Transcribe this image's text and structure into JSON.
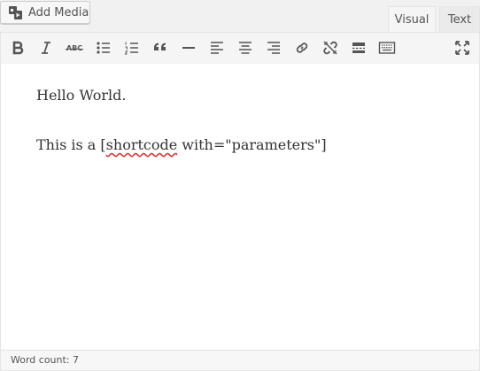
{
  "header": {
    "add_media_label": "Add Media",
    "add_media_icon": "media-icon",
    "tabs": [
      {
        "label": "Visual",
        "active": true
      },
      {
        "label": "Text",
        "active": false
      }
    ]
  },
  "toolbar": {
    "buttons": [
      {
        "name": "bold",
        "icon": "bold-icon"
      },
      {
        "name": "italic",
        "icon": "italic-icon"
      },
      {
        "name": "strikethrough",
        "icon": "strikethrough-icon",
        "glyph": "ABC"
      },
      {
        "name": "bulleted-list",
        "icon": "bulleted-list-icon"
      },
      {
        "name": "numbered-list",
        "icon": "numbered-list-icon"
      },
      {
        "name": "blockquote",
        "icon": "blockquote-icon"
      },
      {
        "name": "horizontal-line",
        "icon": "horizontal-line-icon"
      },
      {
        "name": "align-left",
        "icon": "align-left-icon"
      },
      {
        "name": "align-center",
        "icon": "align-center-icon"
      },
      {
        "name": "align-right",
        "icon": "align-right-icon"
      },
      {
        "name": "insert-link",
        "icon": "link-icon"
      },
      {
        "name": "remove-link",
        "icon": "unlink-icon"
      },
      {
        "name": "read-more",
        "icon": "read-more-icon"
      },
      {
        "name": "toolbar-toggle",
        "icon": "keyboard-icon"
      },
      {
        "name": "fullscreen",
        "icon": "fullscreen-icon"
      }
    ]
  },
  "content": {
    "line1": "Hello World.",
    "line2_before": "This is a [",
    "line2_misspelled": "shortcode",
    "line2_after": " with=\"parameters\"]"
  },
  "status": {
    "word_count": "Word count: 7"
  },
  "colors": {
    "icon": "#555555",
    "spellcheck_underline": "#d63638",
    "toolbar_bg": "#f5f5f5",
    "page_bg": "#f1f1f1"
  }
}
